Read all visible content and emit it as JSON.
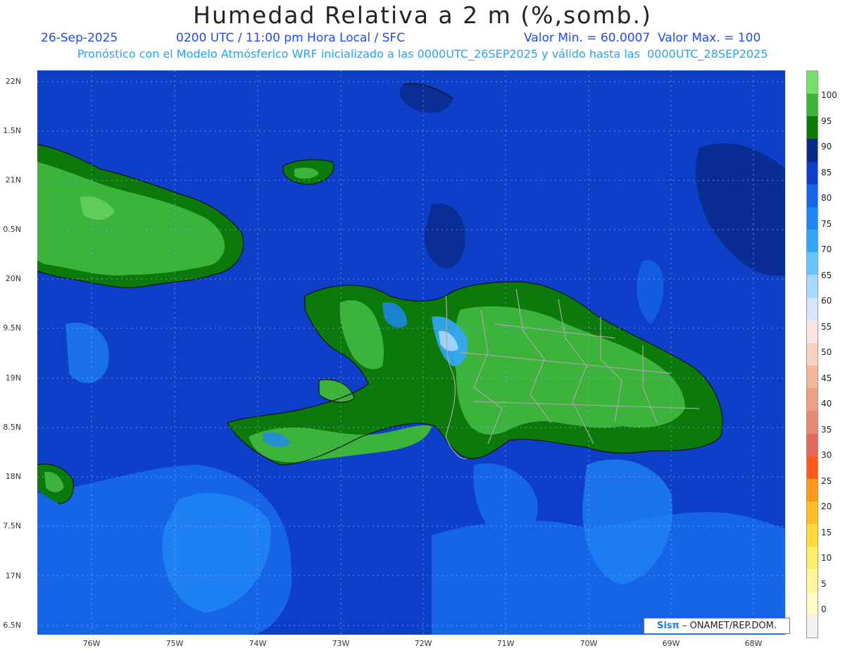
{
  "title": "Humedad Relativa a 2 m (%,somb.)",
  "header": {
    "date": "26-Sep-2025",
    "time": "0200 UTC / 11:00 pm Hora Local / SFC",
    "range": "Valor Min. = 60.0007  Valor Max. = 100",
    "forecast": "Pronóstico con el Modelo Atmósferico WRF inicializado a las 0000UTC_26SEP2025 y válido hasta las  0000UTC_28SEP2025"
  },
  "map": {
    "lat_labels": [
      "22N",
      "1.5N",
      "21N",
      "0.5N",
      "20N",
      "9.5N",
      "19N",
      "8.5N",
      "18N",
      "7.5N",
      "17N",
      "6.5N"
    ],
    "lon_labels": [
      "76W",
      "75W",
      "74W",
      "73W",
      "72W",
      "71W",
      "70W",
      "69W",
      "68W"
    ]
  },
  "colorbar": {
    "labels": [
      "100",
      "95",
      "90",
      "85",
      "80",
      "75",
      "70",
      "65",
      "60",
      "55",
      "50",
      "45",
      "40",
      "35",
      "30",
      "25",
      "20",
      "15",
      "10",
      "5",
      "0"
    ],
    "colors": [
      "#74e06b",
      "#3cb43c",
      "#0b7a0b",
      "#0a2a8a",
      "#0d3fc8",
      "#1565e6",
      "#1f86f5",
      "#34a6ff",
      "#66c4ff",
      "#a8d8ff",
      "#d8e4ff",
      "#fde4e4",
      "#f9d0c4",
      "#f3b79b",
      "#eda182",
      "#e98a76",
      "#e56a5e",
      "#ff5a1e",
      "#ff9a1a",
      "#ffbd28",
      "#ffd83a",
      "#ffec6b",
      "#fff59a",
      "#fffcc8",
      "#f2f2f2"
    ]
  },
  "credit": {
    "brand": "Sisπ",
    "text": "– ONAMET/REP.DOM."
  }
}
